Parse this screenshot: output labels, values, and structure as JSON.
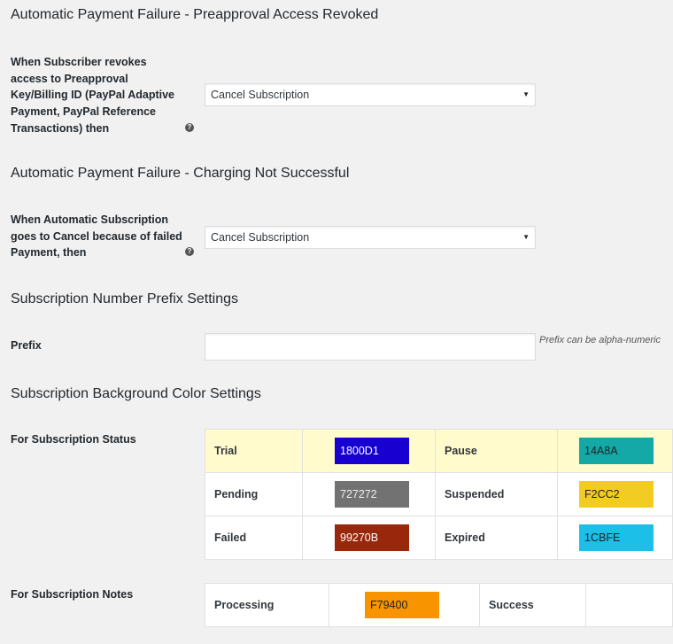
{
  "sections": {
    "preapproval": {
      "title": "Automatic Payment Failure - Preapproval Access Revoked",
      "label": "When Subscriber revokes access to Preapproval Key/Billing ID (PayPal Adaptive Payment, PayPal Reference Transactions) then",
      "select_value": "Cancel Subscription"
    },
    "charging": {
      "title": "Automatic Payment Failure - Charging Not Successful",
      "label": "When Automatic Subscription goes to Cancel because of failed Payment, then",
      "select_value": "Cancel Subscription"
    },
    "prefix": {
      "title": "Subscription Number Prefix Settings",
      "label": "Prefix",
      "value": "",
      "description": "Prefix can be alpha-numeric"
    },
    "colors": {
      "title": "Subscription Background Color Settings",
      "status_label": "For Subscription Status",
      "status_rows": [
        [
          {
            "name": "Trial",
            "hex": "1800D1",
            "bg": "#1800D1",
            "fg": "#ffffff"
          },
          {
            "name": "Pause",
            "hex": "14A8A",
            "bg": "#14A8A6",
            "fg": "#222222"
          }
        ],
        [
          {
            "name": "Pending",
            "hex": "727272",
            "bg": "#727272",
            "fg": "#eeeeee"
          },
          {
            "name": "Suspended",
            "hex": "F2CC2",
            "bg": "#F2CC22",
            "fg": "#222222"
          }
        ],
        [
          {
            "name": "Failed",
            "hex": "99270B",
            "bg": "#99270B",
            "fg": "#ffffff"
          },
          {
            "name": "Expired",
            "hex": "1CBFE",
            "bg": "#1CBFE8",
            "fg": "#222222"
          }
        ]
      ],
      "notes_label": "For Subscription Notes",
      "notes_row": [
        {
          "name": "Processing",
          "hex": "F79400",
          "bg": "#F79400",
          "fg": "#222222"
        },
        {
          "name": "Success"
        }
      ]
    }
  }
}
